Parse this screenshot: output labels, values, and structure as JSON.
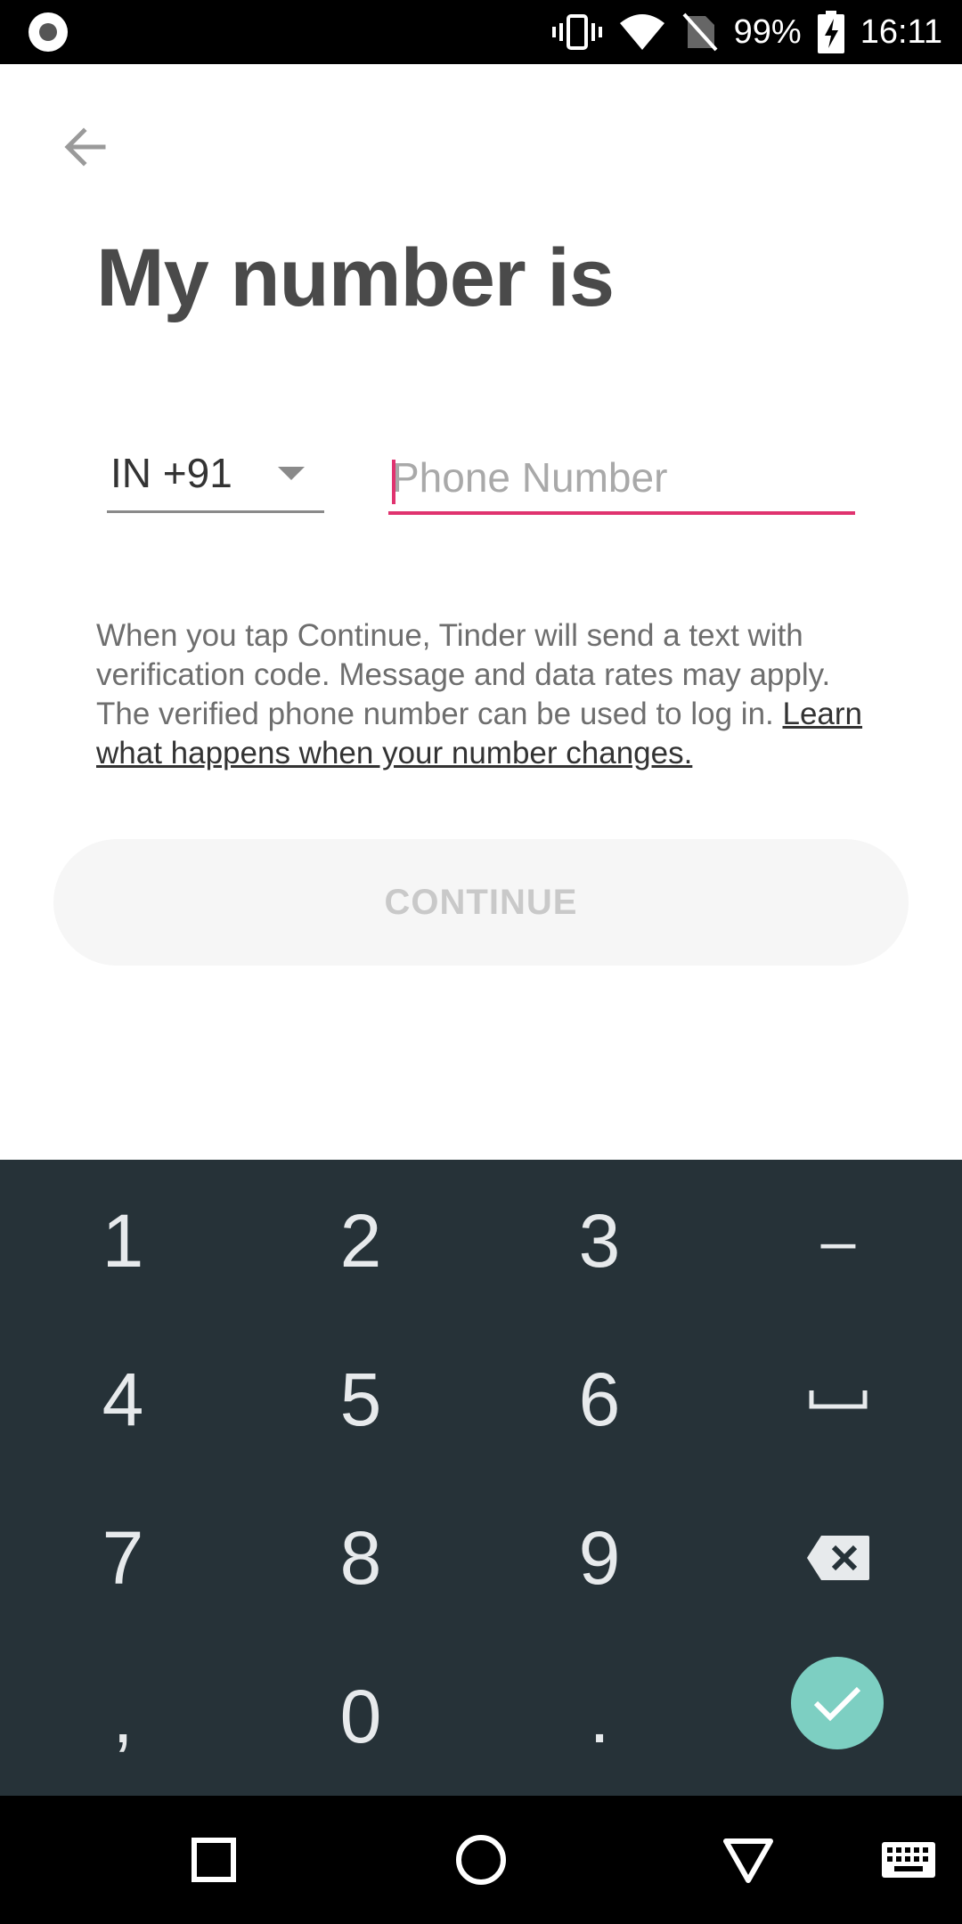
{
  "status_bar": {
    "battery_percent": "99%",
    "time": "16:11",
    "icons": [
      "record-icon",
      "vibrate-icon",
      "wifi-icon",
      "no-sim-icon",
      "battery-charging-icon"
    ]
  },
  "header": {
    "back_icon": "arrow-left-icon",
    "title": "My number is"
  },
  "form": {
    "country_code": "IN +91",
    "phone_value": "",
    "phone_placeholder": "Phone Number",
    "accent_color": "#e0336f"
  },
  "disclaimer": {
    "text": "When you tap Continue, Tinder will send a text with verification code. Message and data rates may apply. The verified phone number can be used to log in. ",
    "link_text": "Learn what happens when your number changes."
  },
  "continue_label": "CONTINUE",
  "keyboard": {
    "keys": [
      "1",
      "2",
      "3",
      "–",
      "4",
      "5",
      "6",
      "␣",
      "7",
      "8",
      "9",
      "⌫",
      ",",
      "0",
      ".",
      "✓"
    ],
    "done_color": "#7dcfc2"
  },
  "nav_bar": {
    "buttons": [
      "recents-square-icon",
      "home-circle-icon",
      "back-triangle-icon",
      "keyboard-icon"
    ]
  }
}
